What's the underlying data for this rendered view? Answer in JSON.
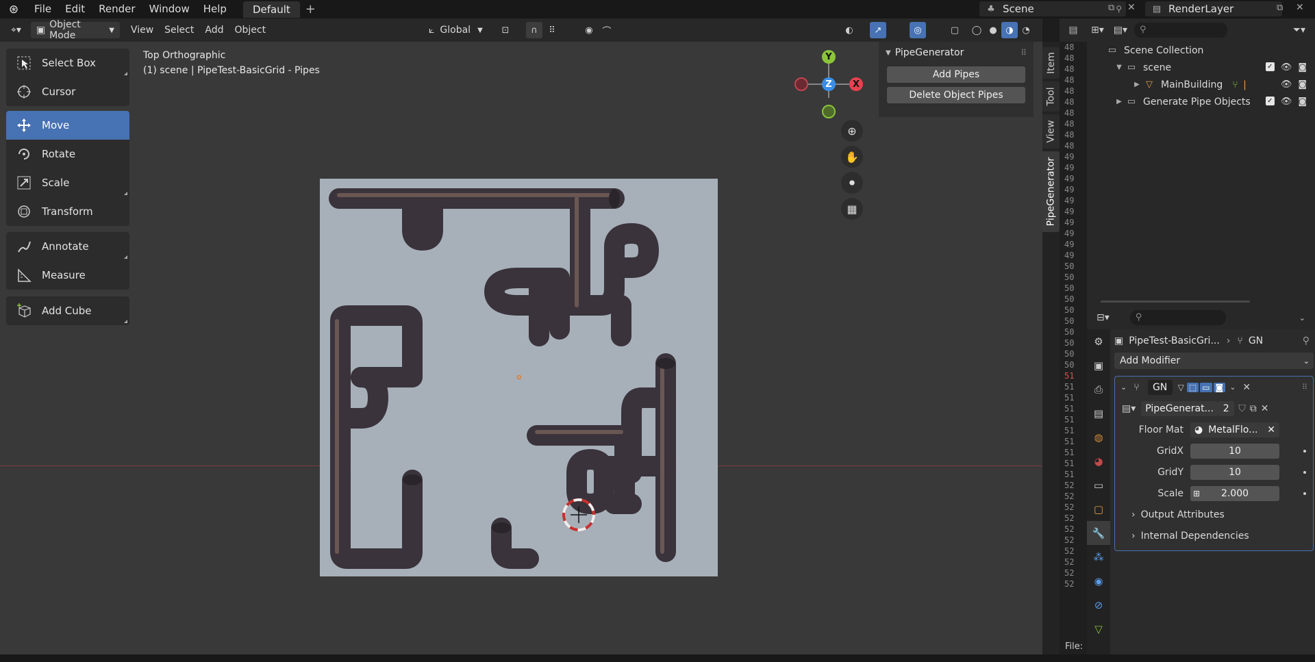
{
  "menubar": {
    "items": [
      "File",
      "Edit",
      "Render",
      "Window",
      "Help"
    ],
    "workspace_tab": "Default",
    "add_workspace": "+",
    "scene": "Scene",
    "view_layer": "RenderLayer"
  },
  "viewport_header": {
    "mode": "Object Mode",
    "menus": [
      "View",
      "Select",
      "Add",
      "Object"
    ],
    "transform_orientation": "Global"
  },
  "toolbar": {
    "tools": [
      {
        "label": "Select Box",
        "icon": "select-box-icon"
      },
      {
        "label": "Cursor",
        "icon": "cursor-icon"
      },
      {
        "label": "Move",
        "icon": "move-icon"
      },
      {
        "label": "Rotate",
        "icon": "rotate-icon"
      },
      {
        "label": "Scale",
        "icon": "scale-icon"
      },
      {
        "label": "Transform",
        "icon": "transform-icon"
      },
      {
        "label": "Annotate",
        "icon": "annotate-icon"
      },
      {
        "label": "Measure",
        "icon": "measure-icon"
      },
      {
        "label": "Add Cube",
        "icon": "add-cube-icon"
      }
    ],
    "active": "Move"
  },
  "viewport": {
    "view_name": "Top Orthographic",
    "object_info": "(1) scene | PipeTest-BasicGrid - Pipes",
    "gizmo": {
      "x": "X",
      "y": "Y",
      "z": "Z"
    },
    "colors": {
      "x_axis": "#e8414f",
      "y_axis": "#8bc43b",
      "z_axis": "#3b8ee8",
      "background": "#393939",
      "floor": "#a7b0b9",
      "accent": "#4772b3"
    }
  },
  "npanel": {
    "title": "PipeGenerator",
    "buttons": [
      "Add Pipes",
      "Delete Object Pipes"
    ],
    "tabs": [
      "Item",
      "Tool",
      "View",
      "PipeGenerator"
    ],
    "active_tab": "PipeGenerator"
  },
  "text_strip": {
    "line_numbers": [
      "48",
      "48",
      "48",
      "48",
      "48",
      "48",
      "48",
      "48",
      "48",
      "48",
      "49",
      "49",
      "49",
      "49",
      "49",
      "49",
      "49",
      "49",
      "49",
      "49",
      "50",
      "50",
      "50",
      "50",
      "50",
      "50",
      "50",
      "50",
      "50",
      "50",
      "51",
      "51",
      "51",
      "51",
      "51",
      "51",
      "51",
      "51",
      "51",
      "51",
      "52",
      "52",
      "52",
      "52",
      "52",
      "52",
      "52",
      "52",
      "52",
      "52"
    ],
    "footer": "File:"
  },
  "outliner": {
    "root": "Scene Collection",
    "items": [
      {
        "label": "scene",
        "depth": 1,
        "expanded": true
      },
      {
        "label": "MainBuilding",
        "depth": 2,
        "expanded": false
      },
      {
        "label": "Generate Pipe Objects",
        "depth": 1,
        "expanded": false
      }
    ]
  },
  "properties": {
    "breadcrumb_object": "PipeTest-BasicGri...",
    "breadcrumb_modifier": "GN",
    "add_modifier": "Add Modifier",
    "modifier": {
      "name": "GN",
      "node_group": "PipeGenerat...",
      "users": "2",
      "params": [
        {
          "label": "Floor Mat",
          "value": "MetalFlo..."
        },
        {
          "label": "GridX",
          "value": "10"
        },
        {
          "label": "GridY",
          "value": "10"
        },
        {
          "label": "Scale",
          "value": "2.000"
        }
      ],
      "panels": [
        "Output Attributes",
        "Internal Dependencies"
      ]
    }
  }
}
